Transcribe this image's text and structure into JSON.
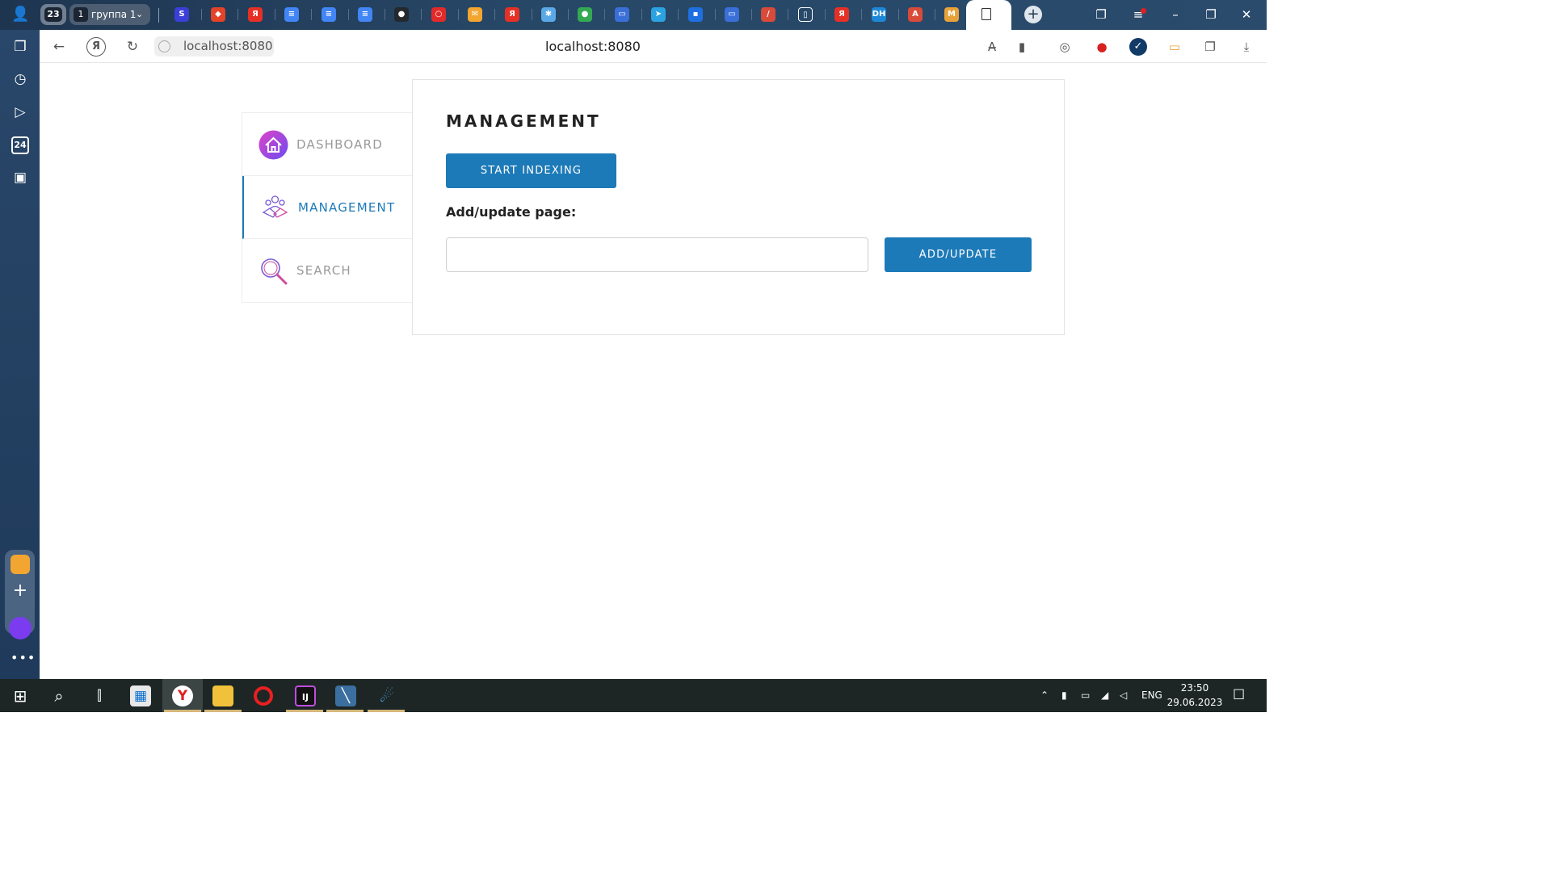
{
  "browser": {
    "tab_count": "23",
    "tab_group": {
      "number": "1",
      "label": "группа 1"
    },
    "favicons": [
      {
        "name": "s-tab",
        "letter": "S",
        "color": "#3b3fd8"
      },
      {
        "name": "gitlab-tab",
        "letter": "◆",
        "color": "#e24329"
      },
      {
        "name": "yandex-tab",
        "letter": "Я",
        "color": "#e63026"
      },
      {
        "name": "docs-tab-1",
        "letter": "≡",
        "color": "#4285f4"
      },
      {
        "name": "docs-tab-2",
        "letter": "≡",
        "color": "#4285f4"
      },
      {
        "name": "docs-tab-3",
        "letter": "≡",
        "color": "#4285f4"
      },
      {
        "name": "github-tab",
        "letter": "●",
        "color": "#24292e"
      },
      {
        "name": "opera-tab",
        "letter": "○",
        "color": "#e32a2a"
      },
      {
        "name": "mail-tab",
        "letter": "✉",
        "color": "#f2a531"
      },
      {
        "name": "yandex-tab-2",
        "letter": "Я",
        "color": "#e63026"
      },
      {
        "name": "app-tab",
        "letter": "✱",
        "color": "#5aa9e6"
      },
      {
        "name": "chrome-tab",
        "letter": "●",
        "color": "#34a853"
      },
      {
        "name": "slides-tab",
        "letter": "▭",
        "color": "#3a6fd8"
      },
      {
        "name": "telegram-tab",
        "letter": "➤",
        "color": "#2aa3e0"
      },
      {
        "name": "chat-tab",
        "letter": "▪",
        "color": "#1e6fe0"
      },
      {
        "name": "slides-tab-2",
        "letter": "▭",
        "color": "#3a6fd8"
      },
      {
        "name": "pen-tab",
        "letter": "/",
        "color": "#d84a3a"
      },
      {
        "name": "doc-tab",
        "letter": "▯",
        "color": "#ffffff"
      },
      {
        "name": "yandex-tab-3",
        "letter": "Я",
        "color": "#e63026"
      },
      {
        "name": "dh-tab",
        "letter": "DH",
        "color": "#1e88d8"
      },
      {
        "name": "a-tab",
        "letter": "A",
        "color": "#d84a3a"
      },
      {
        "name": "m-tab",
        "letter": "M",
        "color": "#e8a23a"
      }
    ],
    "address": "localhost:8080",
    "address_center": "localhost:8080"
  },
  "page": {
    "nav": [
      {
        "label": "DASHBOARD",
        "active": false
      },
      {
        "label": "MANAGEMENT",
        "active": true
      },
      {
        "label": "SEARCH",
        "active": false
      }
    ],
    "title": "MANAGEMENT",
    "start_indexing_label": "START INDEXING",
    "add_label": "Add/update page:",
    "url_input": {
      "value": "",
      "placeholder": ""
    },
    "add_update_label": "ADD/UPDATE",
    "accent_color": "#1d7ab8"
  },
  "taskbar": {
    "lang": "ENG",
    "time": "23:50",
    "date": "29.06.2023"
  }
}
